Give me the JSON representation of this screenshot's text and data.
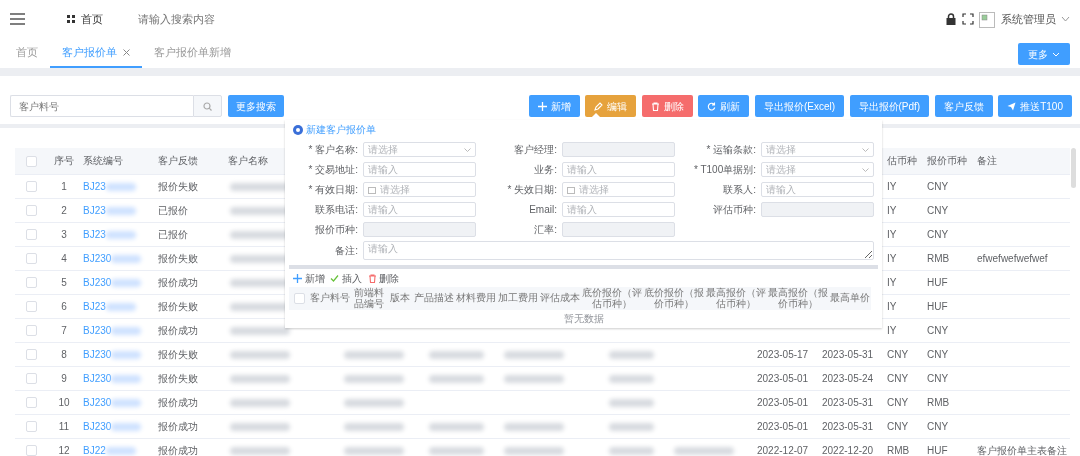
{
  "header": {
    "breadcrumb": "首页",
    "search": {
      "placeholder": "请输入搜索内容"
    },
    "user": "系统管理员"
  },
  "tabs": [
    {
      "label": "首页",
      "selected": false,
      "closable": false
    },
    {
      "label": "客户报价单",
      "selected": true,
      "closable": true
    },
    {
      "label": "客户报价单新增",
      "selected": false,
      "closable": false
    }
  ],
  "more_button": "更多",
  "filter": {
    "placeholder": "客户料号",
    "button": "更多搜索"
  },
  "actions": [
    {
      "label": "新增",
      "kind": "add",
      "color": "#409eff"
    },
    {
      "label": "编辑",
      "kind": "edit",
      "color": "#e6a23c"
    },
    {
      "label": "删除",
      "kind": "delete",
      "color": "#f56c6c"
    },
    {
      "label": "刷新",
      "kind": "refresh",
      "color": "#409eff"
    },
    {
      "label": "导出报价(Excel)",
      "kind": "plain",
      "color": "#409eff"
    },
    {
      "label": "导出报价(Pdf)",
      "kind": "plain",
      "color": "#409eff"
    },
    {
      "label": "客户反馈",
      "kind": "plain",
      "color": "#409eff"
    },
    {
      "label": "推送T100",
      "kind": "send",
      "color": "#409eff"
    }
  ],
  "table": {
    "all_checked": false,
    "columns": [
      {
        "label": "序号"
      },
      {
        "label": "系统编号"
      },
      {
        "label": "客户反馈"
      },
      {
        "label": "客户名称"
      },
      {},
      {},
      {},
      {},
      {},
      {},
      {},
      {
        "label": "估币种"
      },
      {
        "label": "报价币种"
      },
      {
        "label": "备注"
      }
    ],
    "rows": [
      {
        "checked": false,
        "cells": [
          "1",
          {
            "text": "BJ23",
            "kind": "blurred"
          },
          "报价失败",
          {
            "kind": "blurred"
          },
          null,
          null,
          null,
          null,
          null,
          null,
          null,
          "IY",
          "CNY",
          null
        ]
      },
      {
        "checked": false,
        "cells": [
          "2",
          {
            "text": "BJ23",
            "kind": "blurred"
          },
          "已报价",
          {
            "kind": "blurred"
          },
          null,
          null,
          null,
          null,
          null,
          null,
          null,
          "IY",
          "CNY",
          null
        ]
      },
      {
        "checked": false,
        "cells": [
          "3",
          {
            "text": "BJ23",
            "kind": "blurred"
          },
          "已报价",
          {
            "kind": "blurred"
          },
          null,
          null,
          null,
          null,
          null,
          null,
          null,
          "IY",
          "CNY",
          null
        ]
      },
      {
        "checked": false,
        "cells": [
          "4",
          {
            "text": "BJ230",
            "kind": "blurred"
          },
          "报价失败",
          {
            "kind": "blurred"
          },
          null,
          null,
          null,
          null,
          null,
          null,
          null,
          "IY",
          "RMB",
          "efwefwefwefwef"
        ]
      },
      {
        "checked": false,
        "cells": [
          "5",
          {
            "text": "BJ230",
            "kind": "blurred"
          },
          "报价成功",
          {
            "kind": "blurred"
          },
          null,
          null,
          null,
          null,
          null,
          null,
          null,
          "IY",
          "HUF",
          null
        ]
      },
      {
        "checked": false,
        "cells": [
          "6",
          {
            "text": "BJ23",
            "kind": "blurred"
          },
          "报价失败",
          {
            "kind": "blurred"
          },
          null,
          null,
          null,
          null,
          null,
          null,
          null,
          "IY",
          "HUF",
          null
        ]
      },
      {
        "checked": false,
        "cells": [
          "7",
          {
            "text": "BJ230",
            "kind": "blurred"
          },
          "报价成功",
          {
            "kind": "blurred"
          },
          null,
          null,
          null,
          null,
          null,
          null,
          null,
          "IY",
          "CNY",
          null
        ]
      },
      {
        "checked": false,
        "cells": [
          "8",
          {
            "text": "BJ230",
            "kind": "blurred"
          },
          "报价失败",
          {
            "kind": "blurred"
          },
          {
            "kind": "blurred"
          },
          {
            "kind": "blurred"
          },
          {
            "kind": "blurred"
          },
          {
            "kind": "blurred"
          },
          null,
          "2023-05-17",
          "2023-05-31",
          "CNY",
          "CNY",
          null
        ]
      },
      {
        "checked": false,
        "cells": [
          "9",
          {
            "text": "BJ230",
            "kind": "blurred"
          },
          "报价失败",
          {
            "kind": "blurred"
          },
          {
            "kind": "blurred"
          },
          {
            "kind": "blurred"
          },
          {
            "kind": "blurred"
          },
          {
            "kind": "blurred"
          },
          null,
          "2023-05-01",
          "2023-05-24",
          "CNY",
          "CNY",
          null
        ]
      },
      {
        "checked": false,
        "cells": [
          "10",
          {
            "text": "BJ230",
            "kind": "blurred"
          },
          "报价成功",
          {
            "kind": "blurred"
          },
          {
            "kind": "blurred"
          },
          null,
          null,
          {
            "kind": "blurred"
          },
          null,
          "2023-05-01",
          "2023-05-31",
          "CNY",
          "RMB",
          null
        ]
      },
      {
        "checked": false,
        "cells": [
          "11",
          {
            "text": "BJ230",
            "kind": "blurred"
          },
          "报价成功",
          {
            "kind": "blurred"
          },
          {
            "kind": "blurred"
          },
          {
            "kind": "blurred"
          },
          {
            "kind": "blurred"
          },
          {
            "kind": "blurred"
          },
          null,
          "2023-05-01",
          "2023-05-31",
          "CNY",
          "CNY",
          null
        ]
      },
      {
        "checked": false,
        "cells": [
          "12",
          {
            "text": "BJ22",
            "kind": "blurred"
          },
          "报价成功",
          {
            "kind": "blurred"
          },
          {
            "kind": "blurred"
          },
          {
            "kind": "blurred"
          },
          {
            "kind": "blurred"
          },
          {
            "kind": "blurred"
          },
          {
            "kind": "blurred"
          },
          "2022-12-07",
          "2022-12-20",
          "RMB",
          "HUF",
          "客户报价单主表备注"
        ]
      }
    ]
  },
  "dialog": {
    "title": "新建客户报价单",
    "fields": [
      {
        "label": "* 客户名称:",
        "kind": "select",
        "placeholder": "请选择"
      },
      {
        "label": "客户经理:",
        "kind": "readonly"
      },
      {
        "label": "* 运输条款:",
        "kind": "select",
        "placeholder": "请选择"
      },
      {
        "label": "* 交易地址:",
        "kind": "input",
        "placeholder": "请输入"
      },
      {
        "label": "业务:",
        "kind": "input",
        "placeholder": "请输入"
      },
      {
        "label": "* T100单据别:",
        "kind": "select",
        "placeholder": "请选择"
      },
      {
        "label": "* 有效日期:",
        "kind": "date",
        "placeholder": "请选择"
      },
      {
        "label": "* 失效日期:",
        "kind": "date",
        "placeholder": "请选择"
      },
      {
        "label": "联系人:",
        "kind": "input",
        "placeholder": "请输入"
      },
      {
        "label": "联系电话:",
        "kind": "input",
        "placeholder": "请输入"
      },
      {
        "label": "Email:",
        "kind": "input",
        "placeholder": "请输入"
      },
      {
        "label": "评估币种:",
        "kind": "readonly"
      },
      {
        "label": "报价币种:",
        "kind": "readonly"
      },
      {
        "label": "汇率:",
        "kind": "readonly"
      }
    ],
    "remark": {
      "label": "备注:",
      "placeholder": "请输入"
    },
    "tools": [
      {
        "label": "新增",
        "kind": "add"
      },
      {
        "label": "插入",
        "kind": "insert"
      },
      {
        "label": "删除",
        "kind": "delete"
      }
    ],
    "all_checked": false,
    "columns": [
      "客户料号",
      "前端料品编号",
      "版本",
      "产品描述",
      "材料费用",
      "加工费用",
      "评估成本",
      "底价报价（评估币种）",
      "底价报价（报价币种）",
      "最高报价（评估币种）",
      "最高报价（报价币种）",
      "最高单价"
    ],
    "empty": "暂无数据"
  }
}
